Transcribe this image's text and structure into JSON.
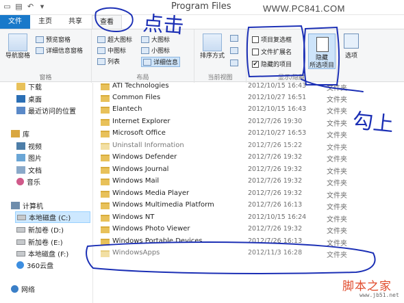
{
  "window": {
    "title": "Program Files",
    "watermark_top": "WWW.PC841.COM",
    "qat_icons": [
      "file-icon",
      "folder-icon",
      "undo-icon",
      "dropdown-icon"
    ],
    "controls": [
      "minimize-icon",
      "maximize-icon",
      "close-icon"
    ]
  },
  "tabs": {
    "file": "文件",
    "home": "主页",
    "share": "共享",
    "view": "查看"
  },
  "ribbon": {
    "pane": {
      "nav_pane": "导航窗格",
      "preview_pane": "预览窗格",
      "details_pane": "详细信息窗格",
      "label": "窗格"
    },
    "layout": {
      "extra_large": "超大图标",
      "large": "大图标",
      "medium": "中图标",
      "small": "小图标",
      "list": "列表",
      "details": "详细信息",
      "label": "布局"
    },
    "current_view": {
      "sort": "排序方式",
      "label": "当前视图"
    },
    "show_hide": {
      "item_checkbox": "项目复选框",
      "file_ext": "文件扩展名",
      "hidden_items": "隐藏的项目",
      "hidden_items_checked": "✔",
      "hide_selected": "隐藏",
      "hide_selected_2": "所选项目",
      "label": "显示/隐藏"
    },
    "options": "选项"
  },
  "nav": {
    "items": [
      {
        "label": "下载",
        "icon": "download-folder-icon"
      },
      {
        "label": "桌面",
        "icon": "desktop-icon"
      },
      {
        "label": "最近访问的位置",
        "icon": "recent-places-icon"
      },
      {
        "label": "库",
        "icon": "library-icon"
      },
      {
        "label": "视频",
        "icon": "video-icon"
      },
      {
        "label": "图片",
        "icon": "pictures-icon"
      },
      {
        "label": "文档",
        "icon": "documents-icon"
      },
      {
        "label": "音乐",
        "icon": "music-icon"
      },
      {
        "label": "计算机",
        "icon": "computer-icon"
      },
      {
        "label": "本地磁盘 (C:)",
        "icon": "drive-icon"
      },
      {
        "label": "新加卷 (D:)",
        "icon": "drive-icon"
      },
      {
        "label": "新加卷 (E:)",
        "icon": "drive-icon"
      },
      {
        "label": "本地磁盘 (F:)",
        "icon": "drive-icon"
      },
      {
        "label": "360云盘",
        "icon": "cloud-drive-icon"
      },
      {
        "label": "网络",
        "icon": "network-icon"
      }
    ]
  },
  "files": [
    {
      "name": "ATI Technologies",
      "date": "2012/10/15 16:43",
      "type": "文件夹"
    },
    {
      "name": "Common Files",
      "date": "2012/10/27 16:51",
      "type": "文件夹"
    },
    {
      "name": "Elantech",
      "date": "2012/10/15 16:43",
      "type": "文件夹"
    },
    {
      "name": "Internet Explorer",
      "date": "2012/7/26 19:30",
      "type": "文件夹"
    },
    {
      "name": "Microsoft Office",
      "date": "2012/10/27 16:53",
      "type": "文件夹"
    },
    {
      "name": "Uninstall Information",
      "date": "2012/7/26 15:22",
      "type": "文件夹"
    },
    {
      "name": "Windows Defender",
      "date": "2012/7/26 19:32",
      "type": "文件夹"
    },
    {
      "name": "Windows Journal",
      "date": "2012/7/26 19:32",
      "type": "文件夹"
    },
    {
      "name": "Windows Mail",
      "date": "2012/7/26 19:32",
      "type": "文件夹"
    },
    {
      "name": "Windows Media Player",
      "date": "2012/7/26 19:32",
      "type": "文件夹"
    },
    {
      "name": "Windows Multimedia Platform",
      "date": "2012/7/26 16:13",
      "type": "文件夹"
    },
    {
      "name": "Windows NT",
      "date": "2012/10/15 16:24",
      "type": "文件夹"
    },
    {
      "name": "Windows Photo Viewer",
      "date": "2012/7/26 19:32",
      "type": "文件夹"
    },
    {
      "name": "Windows Portable Devices",
      "date": "2012/7/26 16:13",
      "type": "文件夹"
    },
    {
      "name": "WindowsApps",
      "date": "2012/11/3 16:28",
      "type": "文件夹"
    }
  ],
  "annotations": {
    "click_note": "点击",
    "check_note": "勾上"
  },
  "watermark": {
    "site_name": "脚本之家",
    "site_url": "www.jb51.net"
  },
  "colors": {
    "accent": "#1979ca",
    "annotation_ink": "#1b2fb5",
    "watermark_red": "#e04a2b"
  }
}
